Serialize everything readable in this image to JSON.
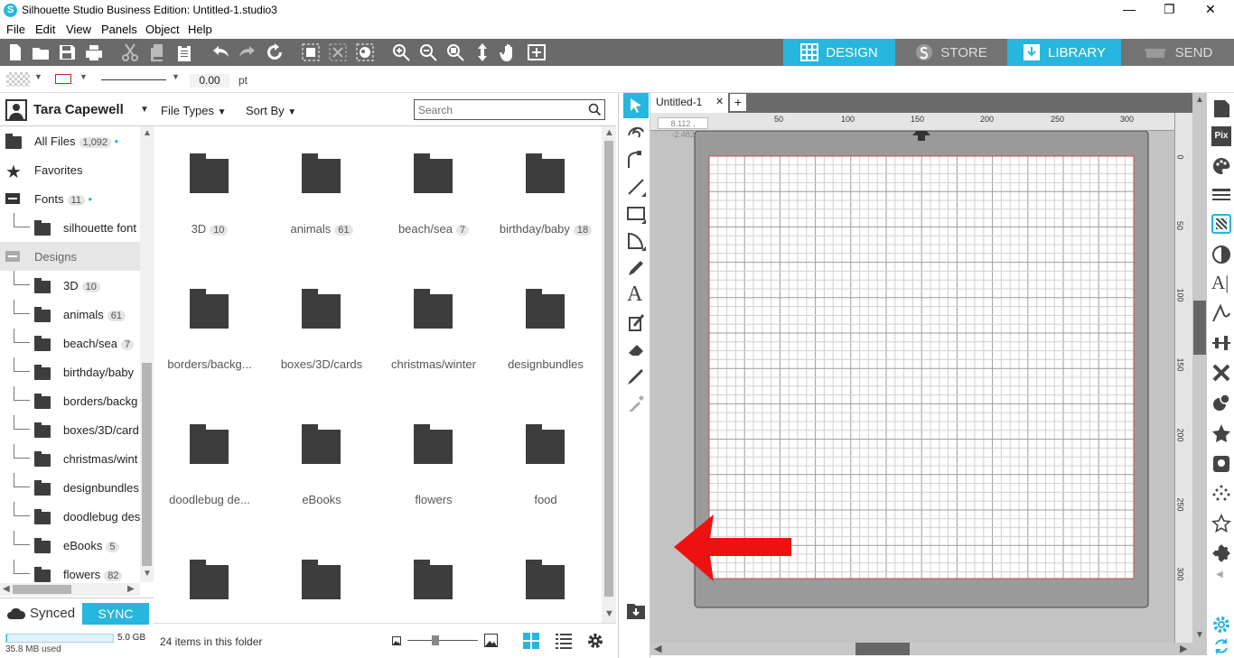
{
  "window": {
    "title": "Silhouette Studio Business Edition: Untitled-1.studio3",
    "controls": {
      "minimize": "—",
      "maximize": "❐",
      "close": "✕"
    }
  },
  "menu": [
    "File",
    "Edit",
    "View",
    "Panels",
    "Object",
    "Help"
  ],
  "mode_tabs": [
    {
      "label": "DESIGN",
      "icon": "grid-icon",
      "active": true
    },
    {
      "label": "STORE",
      "icon": "silhouette-s-icon",
      "active": false
    },
    {
      "label": "LIBRARY",
      "icon": "download-icon",
      "active": false
    },
    {
      "label": "SEND",
      "icon": "cutter-icon",
      "active": false
    }
  ],
  "options": {
    "line_width": "0.00",
    "unit": "pt"
  },
  "library": {
    "user": "Tara Capewell",
    "file_types_label": "File Types",
    "sort_by_label": "Sort By",
    "search_placeholder": "Search",
    "tree": [
      {
        "label": "All Files",
        "count": "1,092",
        "dot": true,
        "icon": "folder",
        "indent": 0
      },
      {
        "label": "Favorites",
        "count": "",
        "dot": false,
        "icon": "star",
        "indent": 0
      },
      {
        "label": "Fonts",
        "count": "11",
        "dot": true,
        "icon": "collapse",
        "indent": 0
      },
      {
        "label": "silhouette font",
        "count": "",
        "dot": false,
        "icon": "folder",
        "indent": 1
      },
      {
        "label": "Designs",
        "count": "",
        "dot": false,
        "icon": "collapse",
        "indent": 0,
        "selected": true
      },
      {
        "label": "3D",
        "count": "10",
        "dot": false,
        "icon": "folder",
        "indent": 1
      },
      {
        "label": "animals",
        "count": "61",
        "dot": false,
        "icon": "folder",
        "indent": 1
      },
      {
        "label": "beach/sea",
        "count": "7",
        "dot": false,
        "icon": "folder",
        "indent": 1
      },
      {
        "label": "birthday/baby",
        "count": "",
        "dot": false,
        "icon": "folder",
        "indent": 1
      },
      {
        "label": "borders/backg",
        "count": "",
        "dot": false,
        "icon": "folder",
        "indent": 1
      },
      {
        "label": "boxes/3D/card",
        "count": "",
        "dot": false,
        "icon": "folder",
        "indent": 1
      },
      {
        "label": "christmas/wint",
        "count": "",
        "dot": false,
        "icon": "folder",
        "indent": 1
      },
      {
        "label": "designbundles",
        "count": "",
        "dot": false,
        "icon": "folder",
        "indent": 1
      },
      {
        "label": "doodlebug des",
        "count": "",
        "dot": false,
        "icon": "folder",
        "indent": 1
      },
      {
        "label": "eBooks",
        "count": "5",
        "dot": false,
        "icon": "folder",
        "indent": 1
      },
      {
        "label": "flowers",
        "count": "82",
        "dot": false,
        "icon": "folder",
        "indent": 1
      }
    ],
    "grid": [
      {
        "label": "3D",
        "count": "10"
      },
      {
        "label": "animals",
        "count": "61"
      },
      {
        "label": "beach/sea",
        "count": "7"
      },
      {
        "label": "birthday/baby",
        "count": "18"
      },
      {
        "label": "borders/backg...",
        "count": ""
      },
      {
        "label": "boxes/3D/cards",
        "count": ""
      },
      {
        "label": "christmas/winter",
        "count": ""
      },
      {
        "label": "designbundles",
        "count": ""
      },
      {
        "label": "doodlebug de...",
        "count": ""
      },
      {
        "label": "eBooks",
        "count": ""
      },
      {
        "label": "flowers",
        "count": ""
      },
      {
        "label": "food",
        "count": ""
      },
      {
        "label": "",
        "count": ""
      },
      {
        "label": "",
        "count": ""
      },
      {
        "label": "",
        "count": ""
      },
      {
        "label": "",
        "count": ""
      }
    ],
    "status": "24 items in this folder",
    "sync": {
      "label": "Synced",
      "button": "SYNC",
      "capacity": "5.0 GB",
      "used": "35.8 MB used",
      "used_fraction": 0.007
    }
  },
  "design": {
    "doc_tab": "Untitled-1",
    "add_tab": "+",
    "coords": "8.112 , -2.482",
    "ruler_top": [
      "50",
      "100",
      "150",
      "200",
      "250",
      "300"
    ],
    "ruler_side": [
      "0",
      "50",
      "100",
      "150",
      "200",
      "250",
      "300"
    ]
  },
  "colors": {
    "accent": "#27b6de",
    "toolbar": "#6a6a6a",
    "arrow": "#ee1111",
    "cutline": "#d04a4a"
  }
}
